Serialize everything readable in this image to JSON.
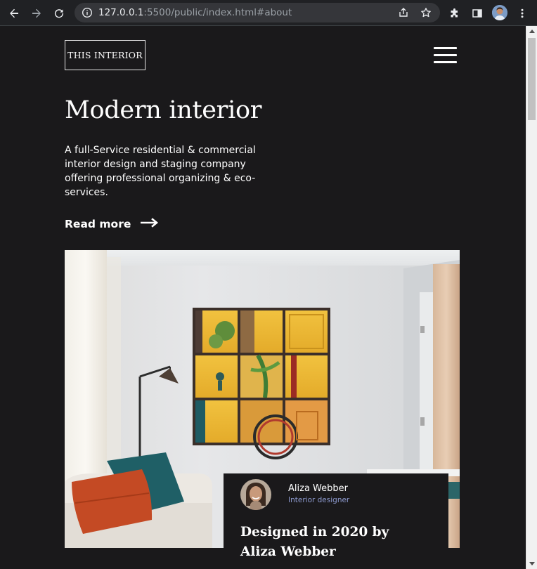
{
  "browser": {
    "url_host": "127.0.0.1",
    "url_path": ":5500/public/index.html#about",
    "icons": [
      "back-arrow-icon",
      "forward-arrow-icon",
      "reload-icon",
      "info-icon",
      "share-icon",
      "star-icon",
      "extensions-icon",
      "side-panel-icon",
      "profile-avatar",
      "more-vert-icon"
    ]
  },
  "header": {
    "logo": "THIS INTERIOR",
    "menu_icon": "hamburger-icon"
  },
  "hero": {
    "title": "Modern interior",
    "description": "A full-Service residential & commercial interior design and staging company offering professional organizing & eco-services.",
    "read_more": "Read more"
  },
  "designer": {
    "name": "Aliza Webber",
    "role": "Interior designer",
    "caption": "Designed in 2020 by Aliza Webber"
  },
  "colors": {
    "page_bg": "#1a191b",
    "accent_role": "#8e9bd0",
    "chrome_bg": "#202124"
  }
}
